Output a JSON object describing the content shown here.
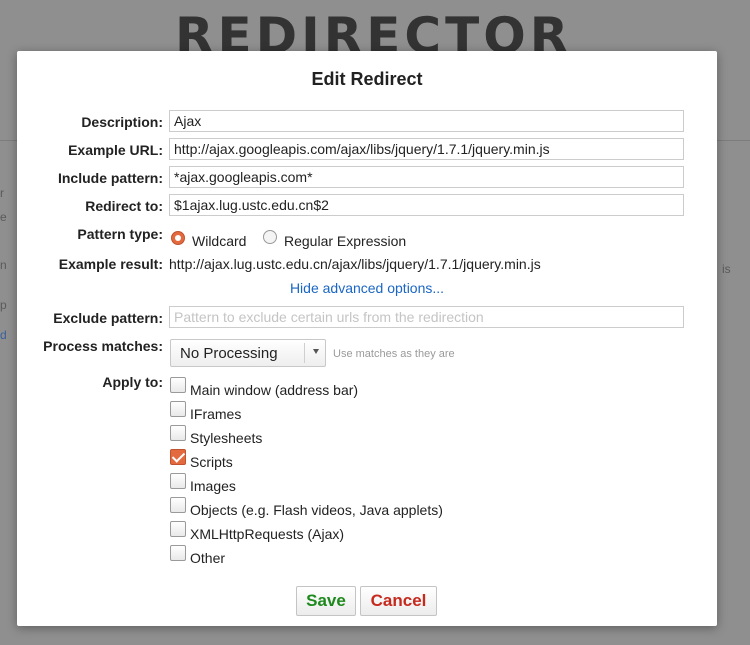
{
  "background": {
    "app_title": "REDIRECTOR"
  },
  "dialog": {
    "title": "Edit Redirect",
    "description": {
      "label": "Description:",
      "value": "Ajax"
    },
    "example_url": {
      "label": "Example URL:",
      "value": "http://ajax.googleapis.com/ajax/libs/jquery/1.7.1/jquery.min.js"
    },
    "include_pattern": {
      "label": "Include pattern:",
      "value": "*ajax.googleapis.com*"
    },
    "redirect_to": {
      "label": "Redirect to:",
      "value": "$1ajax.lug.ustc.edu.cn$2"
    },
    "pattern_type": {
      "label": "Pattern type:",
      "options": [
        {
          "label": "Wildcard",
          "selected": true
        },
        {
          "label": "Regular Expression",
          "selected": false
        }
      ]
    },
    "example_result": {
      "label": "Example result:",
      "value": "http://ajax.lug.ustc.edu.cn/ajax/libs/jquery/1.7.1/jquery.min.js"
    },
    "advanced_link": "Hide advanced options...",
    "exclude_pattern": {
      "label": "Exclude pattern:",
      "value": "",
      "placeholder": "Pattern to exclude certain urls from the redirection"
    },
    "process_matches": {
      "label": "Process matches:",
      "selected": "No Processing",
      "hint": "Use matches as they are"
    },
    "apply_to": {
      "label": "Apply to:",
      "options": [
        {
          "label": "Main window (address bar)",
          "checked": false
        },
        {
          "label": "IFrames",
          "checked": false
        },
        {
          "label": "Stylesheets",
          "checked": false
        },
        {
          "label": "Scripts",
          "checked": true
        },
        {
          "label": "Images",
          "checked": false
        },
        {
          "label": "Objects (e.g. Flash videos, Java applets)",
          "checked": false
        },
        {
          "label": "XMLHttpRequests (Ajax)",
          "checked": false
        },
        {
          "label": "Other",
          "checked": false
        }
      ]
    },
    "save_label": "Save",
    "cancel_label": "Cancel"
  },
  "colors": {
    "accent": "#e36a3f",
    "save": "#1e8a1e",
    "cancel": "#c62a1e",
    "link": "#1a66c4"
  }
}
